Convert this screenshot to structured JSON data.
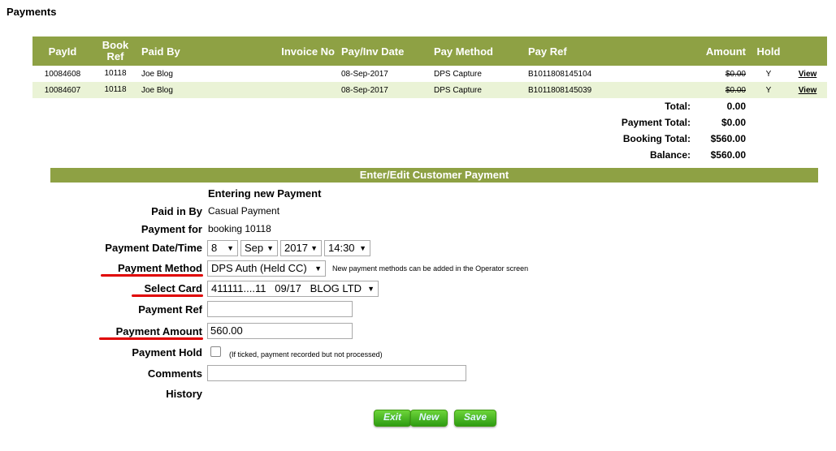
{
  "page_title": "Payments",
  "table": {
    "headers": {
      "payid": "PayId",
      "bookref": "Book Ref",
      "paidby": "Paid By",
      "invoice": "Invoice No",
      "date": "Pay/Inv Date",
      "method": "Pay Method",
      "ref": "Pay Ref",
      "amount": "Amount",
      "hold": "Hold"
    },
    "rows": [
      {
        "payid": "10084608",
        "bookref": "10118",
        "paidby": "Joe Blog",
        "invoice": "",
        "date": "08-Sep-2017",
        "method": "DPS Capture",
        "ref": "B1011808145104",
        "amount": "$0.00",
        "hold": "Y",
        "view": "View"
      },
      {
        "payid": "10084607",
        "bookref": "10118",
        "paidby": "Joe Blog",
        "invoice": "",
        "date": "08-Sep-2017",
        "method": "DPS Capture",
        "ref": "B1011808145039",
        "amount": "$0.00",
        "hold": "Y",
        "view": "View"
      }
    ],
    "totals": [
      {
        "label": "Total:",
        "value": "0.00"
      },
      {
        "label": "Payment Total:",
        "value": "$0.00"
      },
      {
        "label": "Booking Total:",
        "value": "$560.00"
      },
      {
        "label": "Balance:",
        "value": "$560.00"
      }
    ]
  },
  "form": {
    "heading": "Enter/Edit Customer Payment",
    "status": "Entering new Payment",
    "paid_in_by": {
      "label": "Paid in By",
      "value": "Casual Payment"
    },
    "payment_for": {
      "label": "Payment for",
      "value": "booking 10118"
    },
    "date_time": {
      "label": "Payment Date/Time",
      "day": "8",
      "month": "Sep",
      "year": "2017",
      "time": "14:30"
    },
    "method": {
      "label": "Payment Method",
      "value": "DPS Auth (Held CC)",
      "note": "New payment methods can be added in the Operator screen"
    },
    "card": {
      "label": "Select Card",
      "value": "411111....11   09/17   BLOG LTD"
    },
    "ref": {
      "label": "Payment Ref",
      "value": ""
    },
    "amount": {
      "label": "Payment Amount",
      "value": "560.00"
    },
    "hold": {
      "label": "Payment Hold",
      "note": "(If ticked, payment recorded but not processed)",
      "checked": false
    },
    "comments": {
      "label": "Comments",
      "value": ""
    },
    "history": {
      "label": "History"
    }
  },
  "buttons": {
    "exit": "Exit",
    "new": "New",
    "save": "Save"
  },
  "colors": {
    "header_green": "#8ea144",
    "alt_row": "#eaf3d6",
    "underline_red": "#e00000",
    "button_green": "#2e9c12"
  }
}
